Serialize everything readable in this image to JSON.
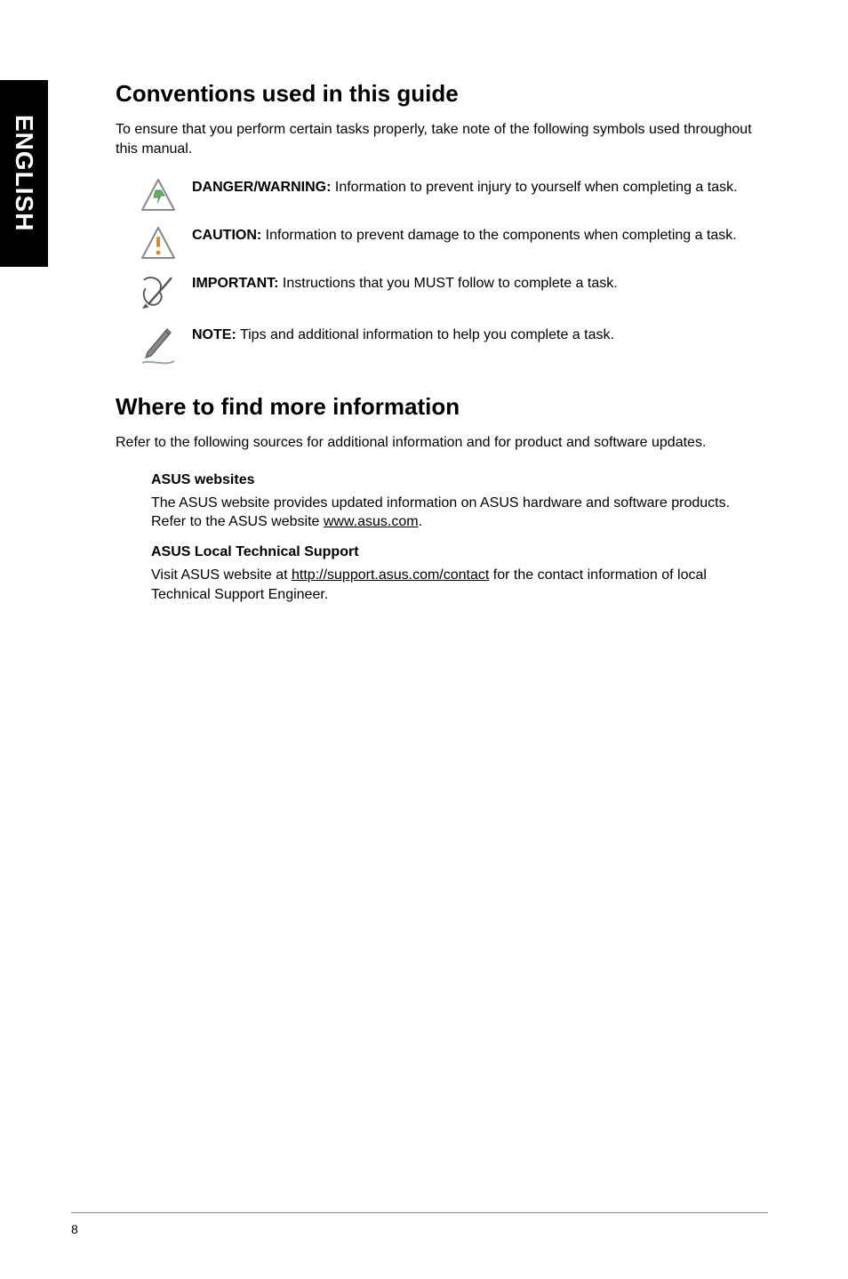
{
  "side_tab": "ENGLISH",
  "section1": {
    "heading": "Conventions used in this guide",
    "intro": "To ensure that you perform certain tasks properly, take note of the following symbols used throughout this manual.",
    "callouts": {
      "danger": {
        "label": "DANGER/WARNING:",
        "text": " Information to prevent injury to yourself when completing a task."
      },
      "caution": {
        "label": "CAUTION:",
        "text": " Information to prevent damage to the components when completing a task."
      },
      "important": {
        "label": "IMPORTANT:",
        "text": " Instructions that you MUST follow to complete a task."
      },
      "note": {
        "label": "NOTE:",
        "text": " Tips and additional information to help you complete a task."
      }
    }
  },
  "section2": {
    "heading": "Where to find more information",
    "intro": "Refer to the following sources for additional information and for product and software updates.",
    "asus_websites": {
      "title": "ASUS websites",
      "body_pre": "The ASUS website provides updated information on ASUS hardware and software products. Refer to the ASUS website ",
      "link": "www.asus.com",
      "body_post": "."
    },
    "local_support": {
      "title": "ASUS Local Technical Support",
      "body_pre": "Visit ASUS website at ",
      "link": "http://support.asus.com/contact",
      "body_post": " for the contact information of local Technical Support Engineer."
    }
  },
  "page_number": "8"
}
